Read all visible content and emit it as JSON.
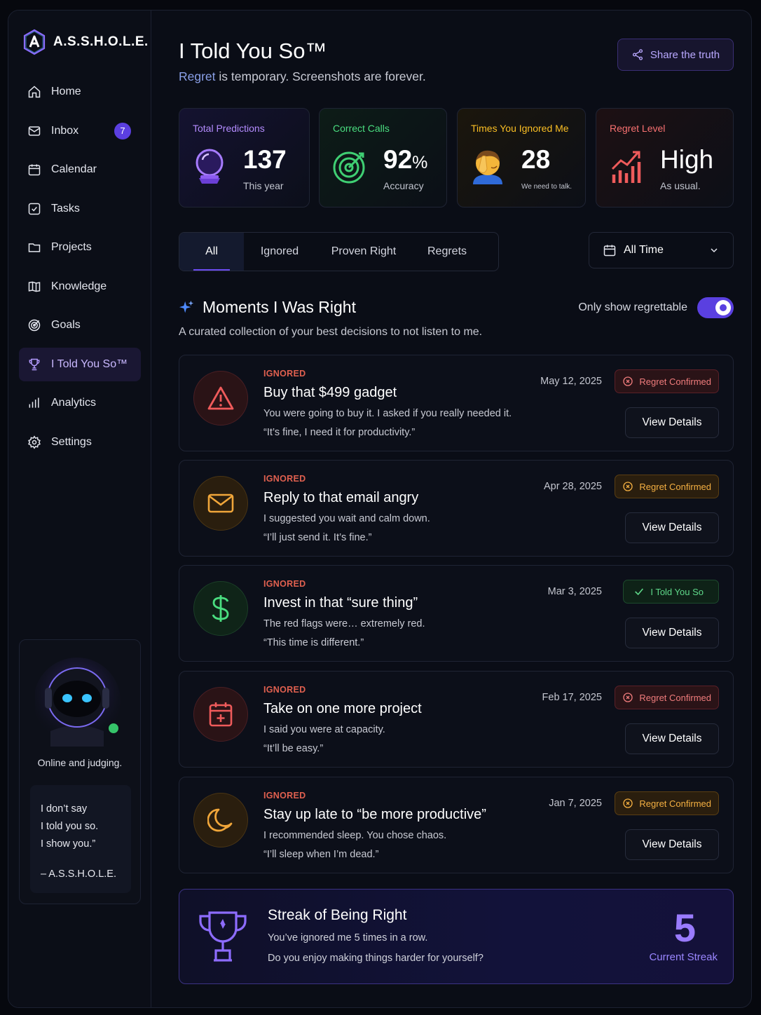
{
  "brand": {
    "name": "A.S.S.H.O.L.E."
  },
  "nav": {
    "items": [
      {
        "label": "Home",
        "icon": "home-icon"
      },
      {
        "label": "Inbox",
        "icon": "mail-icon",
        "badge": "7"
      },
      {
        "label": "Calendar",
        "icon": "calendar-icon"
      },
      {
        "label": "Tasks",
        "icon": "check-square-icon"
      },
      {
        "label": "Projects",
        "icon": "folder-icon"
      },
      {
        "label": "Knowledge",
        "icon": "book-icon"
      },
      {
        "label": "Goals",
        "icon": "target-icon"
      },
      {
        "label": "I Told You So™",
        "icon": "trophy-icon",
        "active": true
      },
      {
        "label": "Analytics",
        "icon": "bar-chart-icon"
      },
      {
        "label": "Settings",
        "icon": "gear-icon"
      }
    ]
  },
  "bot": {
    "status": "Online and judging.",
    "quote_lines": [
      "I don’t say",
      "I told you so.",
      "I show you.”"
    ],
    "quote_by": "– A.S.S.H.O.L.E."
  },
  "header": {
    "title": "I Told You So™",
    "subtitle_highlight": "Regret",
    "subtitle_rest": " is temporary. Screenshots are forever.",
    "share_label": "Share the truth"
  },
  "stats": [
    {
      "label": "Total Predictions",
      "value": "137",
      "unit": "",
      "sub": "This year",
      "color": "#b48cff"
    },
    {
      "label": "Correct Calls",
      "value": "92",
      "unit": "%",
      "sub": "Accuracy",
      "color": "#4ade80"
    },
    {
      "label": "Times You Ignored Me",
      "value": "28",
      "unit": "",
      "sub": "We need to talk.",
      "color": "#fbbf24"
    },
    {
      "label": "Regret Level",
      "value": "High",
      "unit": "",
      "sub": "As usual.",
      "color": "#f87171"
    }
  ],
  "tabs": [
    "All",
    "Ignored",
    "Proven Right",
    "Regrets"
  ],
  "filter": {
    "time": "All Time"
  },
  "section": {
    "title": "Moments I Was Right",
    "subtitle": "A curated collection of your best decisions to not listen to me.",
    "toggle_label": "Only show regrettable",
    "toggle_on": true
  },
  "moments": [
    {
      "tag": "IGNORED",
      "title": "Buy that $499 gadget",
      "desc": "You were going to buy it. I asked if you really needed it.",
      "quote": "“It’s fine, I need it for productivity.”",
      "date": "May 12, 2025",
      "status": "Regret Confirmed",
      "icon": "warning-icon",
      "action": "View Details"
    },
    {
      "tag": "IGNORED",
      "title": "Reply to that email angry",
      "desc": "I suggested you wait and calm down.",
      "quote": "“I’ll just send it. It’s fine.”",
      "date": "Apr 28, 2025",
      "status": "Regret Confirmed",
      "icon": "mail-icon",
      "action": "View Details"
    },
    {
      "tag": "IGNORED",
      "title": "Invest in that “sure thing”",
      "desc": "The red flags were… extremely red.",
      "quote": "“This time is different.”",
      "date": "Mar 3, 2025",
      "status": "I Told You So",
      "icon": "dollar-icon",
      "action": "View Details"
    },
    {
      "tag": "IGNORED",
      "title": "Take on one more project",
      "desc": "I said you were at capacity.",
      "quote": "“It’ll be easy.”",
      "date": "Feb 17, 2025",
      "status": "Regret Confirmed",
      "icon": "calendar-plus-icon",
      "action": "View Details"
    },
    {
      "tag": "IGNORED",
      "title": "Stay up late to “be more productive”",
      "desc": "I recommended sleep. You chose chaos.",
      "quote": "“I’ll sleep when I’m dead.”",
      "date": "Jan 7, 2025",
      "status": "Regret Confirmed",
      "icon": "moon-icon",
      "action": "View Details"
    }
  ],
  "streak": {
    "title": "Streak of Being Right",
    "desc": "You’ve ignored me 5 times in a row.",
    "question": "Do you enjoy making things harder for yourself?",
    "value": "5",
    "label": "Current Streak"
  }
}
